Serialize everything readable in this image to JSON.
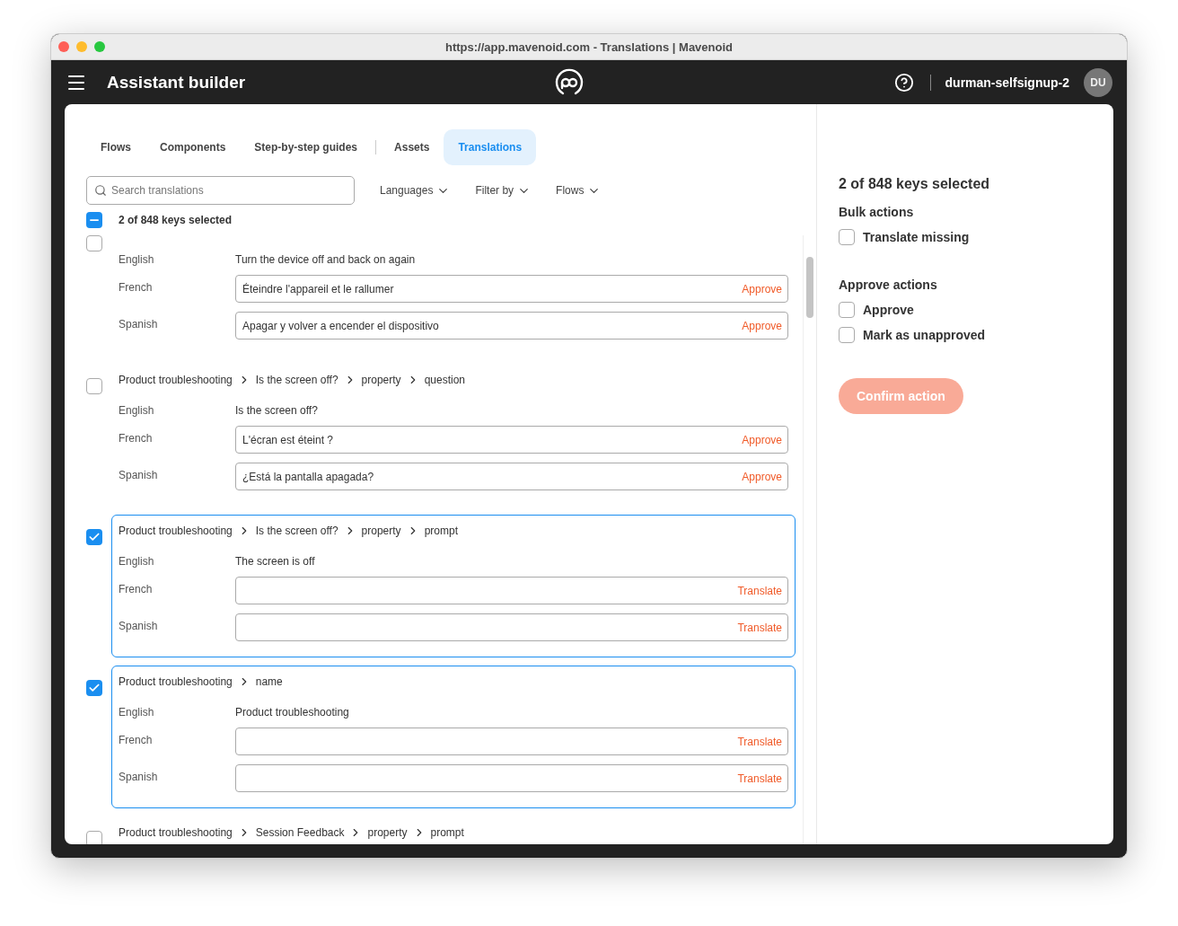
{
  "window": {
    "title": "https://app.mavenoid.com - Translations | Mavenoid"
  },
  "app_bar": {
    "title": "Assistant builder",
    "user": "durman-selfsignup-2",
    "avatar": "DU"
  },
  "tabs": [
    {
      "label": "Flows",
      "selected": false
    },
    {
      "label": "Components",
      "selected": false
    },
    {
      "label": "Step-by-step guides",
      "selected": false
    },
    {
      "label": "Assets",
      "selected": false
    },
    {
      "label": "Translations",
      "selected": true
    }
  ],
  "search": {
    "placeholder": "Search translations"
  },
  "filters": [
    "Languages",
    "Filter by",
    "Flows"
  ],
  "select_all": {
    "checked": true,
    "partial": true,
    "label": "2 of 848 keys selected"
  },
  "keys": [
    {
      "selected": false,
      "rows": [
        {
          "language": "English",
          "kind": "source",
          "value": "Turn the device off and back on again"
        },
        {
          "language": "French",
          "kind": "field",
          "value": "Éteindre l'appareil et le rallumer",
          "action": "Approve"
        },
        {
          "language": "Spanish",
          "kind": "field",
          "value": "Apagar y volver a encender el dispositivo",
          "action": "Approve"
        }
      ]
    },
    {
      "selected": false,
      "path": [
        "Product troubleshooting",
        "Is the screen off?",
        "property",
        "question"
      ],
      "rows": [
        {
          "language": "English",
          "kind": "source",
          "value": "Is the screen off?"
        },
        {
          "language": "French",
          "kind": "field",
          "value": "L'écran est éteint ?",
          "action": "Approve"
        },
        {
          "language": "Spanish",
          "kind": "field",
          "value": "¿Está la pantalla apagada?",
          "action": "Approve"
        }
      ]
    },
    {
      "selected": true,
      "path": [
        "Product troubleshooting",
        "Is the screen off?",
        "property",
        "prompt"
      ],
      "rows": [
        {
          "language": "English",
          "kind": "source",
          "value": "The screen is off"
        },
        {
          "language": "French",
          "kind": "field",
          "action": "Translate"
        },
        {
          "language": "Spanish",
          "kind": "field",
          "action": "Translate"
        }
      ]
    },
    {
      "selected": true,
      "path": [
        "Product troubleshooting",
        "name"
      ],
      "rows": [
        {
          "language": "English",
          "kind": "source",
          "value": "Product troubleshooting"
        },
        {
          "language": "French",
          "kind": "field",
          "action": "Translate"
        },
        {
          "language": "Spanish",
          "kind": "field",
          "action": "Translate"
        }
      ]
    },
    {
      "selected": false,
      "path": [
        "Product troubleshooting",
        "Session Feedback",
        "property",
        "prompt"
      ]
    }
  ],
  "side_panel": {
    "heading": "2 of 848 keys selected",
    "groups": [
      {
        "title": "Bulk actions",
        "options": [
          {
            "label": "Translate missing",
            "checked": false
          }
        ]
      },
      {
        "title": "Approve actions",
        "options": [
          {
            "label": "Approve",
            "checked": false
          },
          {
            "label": "Mark as unapproved",
            "checked": false
          }
        ]
      }
    ],
    "confirm": {
      "label": "Confirm action",
      "disabled": true
    }
  }
}
